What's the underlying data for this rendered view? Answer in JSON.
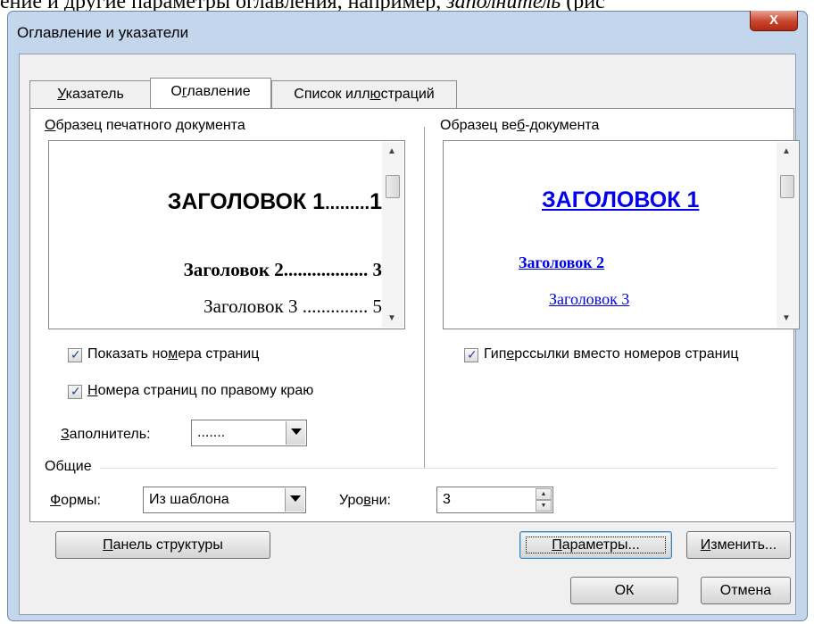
{
  "background_text": {
    "prefix": "ение и другие параметры оглавления, например, ",
    "italic": "заполнитель",
    "suffix": " (рис"
  },
  "dialog": {
    "title": "Оглавление и указатели",
    "close_label": "X"
  },
  "tabs": [
    {
      "label": "Указатель",
      "mnemonic": "У",
      "rest": "казатель"
    },
    {
      "label": "Оглавление",
      "pre": "О",
      "mnemonic": "г",
      "rest": "лавление"
    },
    {
      "label": "Список иллюстраций",
      "pre": "Список илл",
      "mnemonic": "ю",
      "rest": "страций"
    }
  ],
  "print_preview": {
    "label_mnemonic": "О",
    "label_rest": "бразец печатного документа",
    "heading1": "ЗАГОЛОВОК 1",
    "heading1_leader": ".........",
    "heading1_page": "1",
    "heading2": "Заголовок 2",
    "heading2_leader": "..................",
    "heading2_page": "3",
    "heading3": "Заголовок 3",
    "heading3_leader": "..............",
    "heading3_page": "5"
  },
  "web_preview": {
    "label_pre": "Образец ве",
    "label_mnemonic": "б",
    "label_rest": "-документа",
    "heading1": "ЗАГОЛОВОК 1",
    "heading2": "Заголовок 2",
    "heading3": "Заголовок 3",
    "link_color": "#0000ee"
  },
  "options": {
    "show_page_numbers_pre": "Показать но",
    "show_page_numbers_mnemonic": "м",
    "show_page_numbers_rest": "ера страниц",
    "right_align_mnemonic": "Н",
    "right_align_rest": "омера страниц по правому краю",
    "hyperlinks_pre": "Гип",
    "hyperlinks_mnemonic": "е",
    "hyperlinks_rest": "рссылки вместо номеров страниц",
    "leader_label_mnemonic": "З",
    "leader_label_rest": "аполнитель:",
    "leader_value": "......."
  },
  "general": {
    "group_label": "Общие",
    "formats_label_mnemonic": "Ф",
    "formats_label_rest": "ормы:",
    "formats_value": "Из шаблона",
    "levels_label_pre": "Уро",
    "levels_label_mnemonic": "в",
    "levels_label_rest": "ни:",
    "levels_value": "3"
  },
  "buttons": {
    "outline_toolbar_mnemonic": "П",
    "outline_toolbar_rest": "анель структуры",
    "options_mnemonic": "П",
    "options_rest": "араметры...",
    "modify_mnemonic": "И",
    "modify_rest": "зменить...",
    "ok": "ОК",
    "cancel": "Отмена"
  }
}
